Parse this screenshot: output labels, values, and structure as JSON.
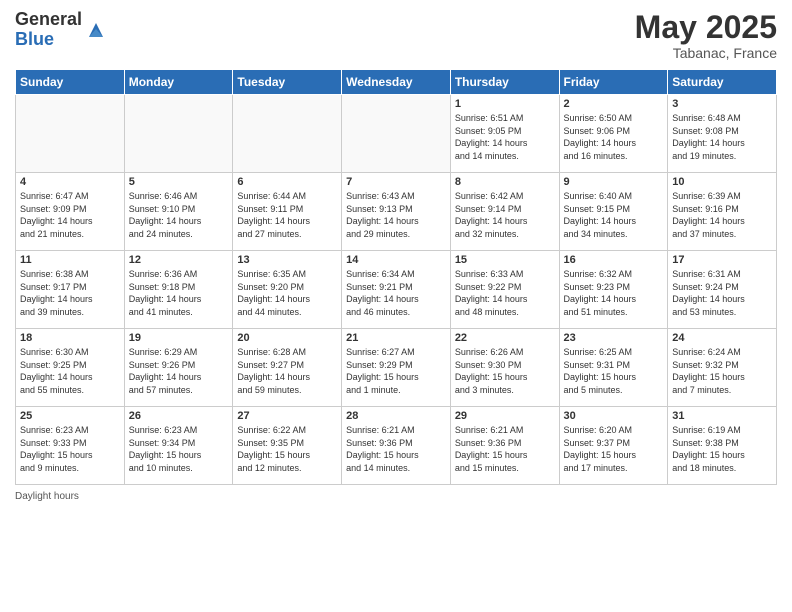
{
  "header": {
    "logo_general": "General",
    "logo_blue": "Blue",
    "month": "May 2025",
    "location": "Tabanac, France"
  },
  "days_of_week": [
    "Sunday",
    "Monday",
    "Tuesday",
    "Wednesday",
    "Thursday",
    "Friday",
    "Saturday"
  ],
  "weeks": [
    [
      {
        "day": "",
        "info": ""
      },
      {
        "day": "",
        "info": ""
      },
      {
        "day": "",
        "info": ""
      },
      {
        "day": "",
        "info": ""
      },
      {
        "day": "1",
        "info": "Sunrise: 6:51 AM\nSunset: 9:05 PM\nDaylight: 14 hours\nand 14 minutes."
      },
      {
        "day": "2",
        "info": "Sunrise: 6:50 AM\nSunset: 9:06 PM\nDaylight: 14 hours\nand 16 minutes."
      },
      {
        "day": "3",
        "info": "Sunrise: 6:48 AM\nSunset: 9:08 PM\nDaylight: 14 hours\nand 19 minutes."
      }
    ],
    [
      {
        "day": "4",
        "info": "Sunrise: 6:47 AM\nSunset: 9:09 PM\nDaylight: 14 hours\nand 21 minutes."
      },
      {
        "day": "5",
        "info": "Sunrise: 6:46 AM\nSunset: 9:10 PM\nDaylight: 14 hours\nand 24 minutes."
      },
      {
        "day": "6",
        "info": "Sunrise: 6:44 AM\nSunset: 9:11 PM\nDaylight: 14 hours\nand 27 minutes."
      },
      {
        "day": "7",
        "info": "Sunrise: 6:43 AM\nSunset: 9:13 PM\nDaylight: 14 hours\nand 29 minutes."
      },
      {
        "day": "8",
        "info": "Sunrise: 6:42 AM\nSunset: 9:14 PM\nDaylight: 14 hours\nand 32 minutes."
      },
      {
        "day": "9",
        "info": "Sunrise: 6:40 AM\nSunset: 9:15 PM\nDaylight: 14 hours\nand 34 minutes."
      },
      {
        "day": "10",
        "info": "Sunrise: 6:39 AM\nSunset: 9:16 PM\nDaylight: 14 hours\nand 37 minutes."
      }
    ],
    [
      {
        "day": "11",
        "info": "Sunrise: 6:38 AM\nSunset: 9:17 PM\nDaylight: 14 hours\nand 39 minutes."
      },
      {
        "day": "12",
        "info": "Sunrise: 6:36 AM\nSunset: 9:18 PM\nDaylight: 14 hours\nand 41 minutes."
      },
      {
        "day": "13",
        "info": "Sunrise: 6:35 AM\nSunset: 9:20 PM\nDaylight: 14 hours\nand 44 minutes."
      },
      {
        "day": "14",
        "info": "Sunrise: 6:34 AM\nSunset: 9:21 PM\nDaylight: 14 hours\nand 46 minutes."
      },
      {
        "day": "15",
        "info": "Sunrise: 6:33 AM\nSunset: 9:22 PM\nDaylight: 14 hours\nand 48 minutes."
      },
      {
        "day": "16",
        "info": "Sunrise: 6:32 AM\nSunset: 9:23 PM\nDaylight: 14 hours\nand 51 minutes."
      },
      {
        "day": "17",
        "info": "Sunrise: 6:31 AM\nSunset: 9:24 PM\nDaylight: 14 hours\nand 53 minutes."
      }
    ],
    [
      {
        "day": "18",
        "info": "Sunrise: 6:30 AM\nSunset: 9:25 PM\nDaylight: 14 hours\nand 55 minutes."
      },
      {
        "day": "19",
        "info": "Sunrise: 6:29 AM\nSunset: 9:26 PM\nDaylight: 14 hours\nand 57 minutes."
      },
      {
        "day": "20",
        "info": "Sunrise: 6:28 AM\nSunset: 9:27 PM\nDaylight: 14 hours\nand 59 minutes."
      },
      {
        "day": "21",
        "info": "Sunrise: 6:27 AM\nSunset: 9:29 PM\nDaylight: 15 hours\nand 1 minute."
      },
      {
        "day": "22",
        "info": "Sunrise: 6:26 AM\nSunset: 9:30 PM\nDaylight: 15 hours\nand 3 minutes."
      },
      {
        "day": "23",
        "info": "Sunrise: 6:25 AM\nSunset: 9:31 PM\nDaylight: 15 hours\nand 5 minutes."
      },
      {
        "day": "24",
        "info": "Sunrise: 6:24 AM\nSunset: 9:32 PM\nDaylight: 15 hours\nand 7 minutes."
      }
    ],
    [
      {
        "day": "25",
        "info": "Sunrise: 6:23 AM\nSunset: 9:33 PM\nDaylight: 15 hours\nand 9 minutes."
      },
      {
        "day": "26",
        "info": "Sunrise: 6:23 AM\nSunset: 9:34 PM\nDaylight: 15 hours\nand 10 minutes."
      },
      {
        "day": "27",
        "info": "Sunrise: 6:22 AM\nSunset: 9:35 PM\nDaylight: 15 hours\nand 12 minutes."
      },
      {
        "day": "28",
        "info": "Sunrise: 6:21 AM\nSunset: 9:36 PM\nDaylight: 15 hours\nand 14 minutes."
      },
      {
        "day": "29",
        "info": "Sunrise: 6:21 AM\nSunset: 9:36 PM\nDaylight: 15 hours\nand 15 minutes."
      },
      {
        "day": "30",
        "info": "Sunrise: 6:20 AM\nSunset: 9:37 PM\nDaylight: 15 hours\nand 17 minutes."
      },
      {
        "day": "31",
        "info": "Sunrise: 6:19 AM\nSunset: 9:38 PM\nDaylight: 15 hours\nand 18 minutes."
      }
    ]
  ],
  "footer": {
    "label": "Daylight hours"
  }
}
